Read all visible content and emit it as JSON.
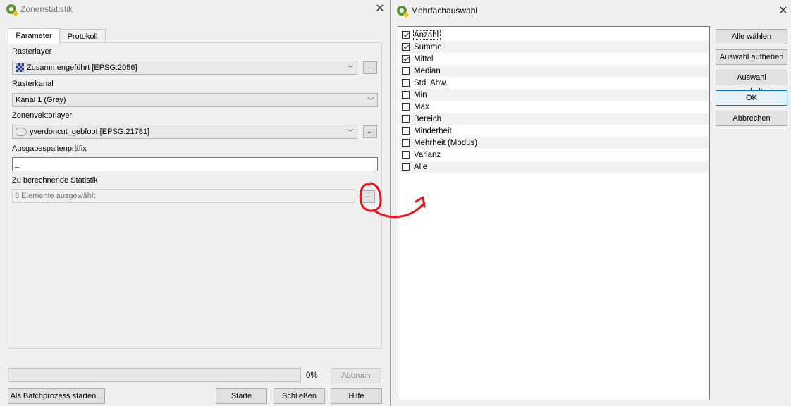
{
  "left_window": {
    "title": "Zonenstatistik",
    "tabs": [
      "Parameter",
      "Protokoll"
    ],
    "raster_layer": {
      "label": "Rasterlayer",
      "value": "Zusammengeführt [EPSG:2056]"
    },
    "raster_band": {
      "label": "Rasterkanal",
      "value": "Kanal 1 (Gray)"
    },
    "zone_vector_layer": {
      "label": "Zonenvektorlayer",
      "value": "yverdoncut_gebfoot [EPSG:21781]"
    },
    "output_prefix": {
      "label": "Ausgabespaltenpräfix",
      "value": "_"
    },
    "statistics": {
      "label": "Zu berechnende Statistik",
      "value": "3 Elemente ausgewählt"
    },
    "ellipsis": "...",
    "progress_text": "0%",
    "buttons": {
      "cancel": "Abbruch",
      "batch": "Als Batchprozess starten...",
      "run": "Starte",
      "close": "Schließen",
      "help": "Hilfe"
    }
  },
  "right_window": {
    "title": "Mehrfachauswahl",
    "items": [
      {
        "label": "Anzahl",
        "checked": true
      },
      {
        "label": "Summe",
        "checked": true
      },
      {
        "label": "Mittel",
        "checked": true
      },
      {
        "label": "Median",
        "checked": false
      },
      {
        "label": "Std. Abw.",
        "checked": false
      },
      {
        "label": "Min",
        "checked": false
      },
      {
        "label": "Max",
        "checked": false
      },
      {
        "label": "Bereich",
        "checked": false
      },
      {
        "label": "Minderheit",
        "checked": false
      },
      {
        "label": "Mehrheit (Modus)",
        "checked": false
      },
      {
        "label": "Varianz",
        "checked": false
      },
      {
        "label": "Alle",
        "checked": false
      }
    ],
    "buttons": {
      "select_all": "Alle wählen",
      "clear_selection": "Auswahl aufheben",
      "toggle_selection": "Auswahl umschalten",
      "ok": "OK",
      "cancel": "Abbrechen"
    }
  },
  "colors": {
    "annotation": "#e8141e",
    "qgis_green": "#589632",
    "focus_blue": "#0078d7"
  },
  "icons": [
    "qgis-icon",
    "close-icon",
    "raster-layer-icon",
    "polygon-layer-icon",
    "chevron-down-icon",
    "checkbox-icon"
  ]
}
